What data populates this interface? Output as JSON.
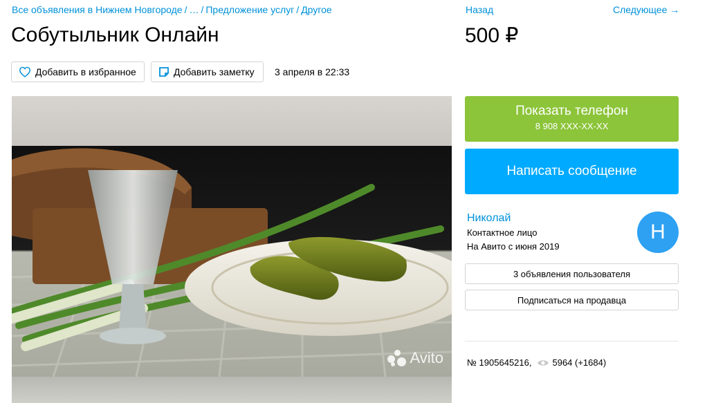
{
  "breadcrumb": {
    "items": [
      "Все объявления в Нижнем Новгороде",
      "…",
      "Предложение услуг",
      "Другое"
    ]
  },
  "ad": {
    "title": "Собутыльник Онлайн",
    "price": "500 ₽",
    "date": "3 апреля в 22:33",
    "number": "№ 1905645216,",
    "views": "5964 (+1684)"
  },
  "actions": {
    "favorite_label": "Добавить в избранное",
    "note_label": "Добавить заметку"
  },
  "nav": {
    "back_label": "Назад",
    "next_label": "Следующее →"
  },
  "contact": {
    "phone_label": "Показать телефон",
    "phone_masked": "8 908 XXX-XX-XX",
    "message_label": "Написать сообщение"
  },
  "seller": {
    "name": "Николай",
    "role": "Контактное лицо",
    "since": "На Авито с июня 2019",
    "avatar_letter": "Н",
    "ads_button_label": "3 объявления пользователя",
    "subscribe_button_label": "Подписаться на продавца"
  },
  "photo": {
    "watermark": "Avito",
    "description_icon": "photo-image"
  },
  "colors": {
    "link": "#0091d9",
    "phone_button": "#8cc43a",
    "message_button": "#00aaff",
    "avatar": "#2ea1f2"
  }
}
